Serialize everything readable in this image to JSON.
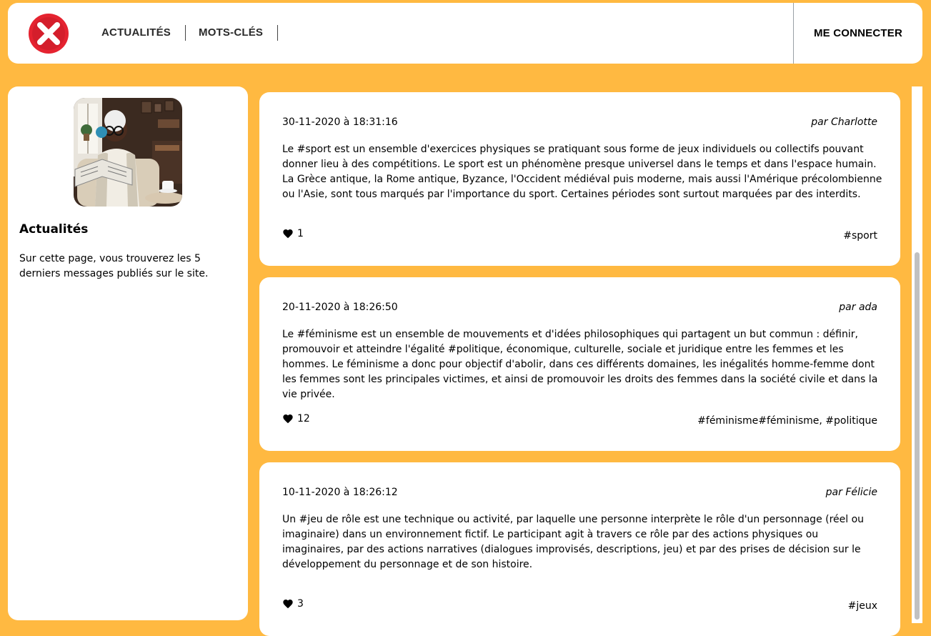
{
  "header": {
    "logo_icon": "close-x-icon",
    "nav": [
      "ACTUALITÉS",
      "MOTS-CLÉS"
    ],
    "login_label": "ME CONNECTER"
  },
  "sidebar": {
    "title": "Actualités",
    "text": "Sur cette page, vous trouverez les 5 derniers messages publiés sur le site."
  },
  "posts": [
    {
      "date": "30-11-2020 à 18:31:16",
      "author": "par Charlotte",
      "text": "Le #sport est un ensemble d'exercices physiques se pratiquant sous forme de jeux individuels ou collectifs pouvant donner lieu à des compétitions. Le sport est un phénomène presque universel dans le temps et dans l'espace humain. La Grèce antique, la Rome antique, Byzance, l'Occident médiéval puis moderne, mais aussi l'Amérique précolombienne ou l'Asie, sont tous marqués par l'importance du sport. Certaines périodes sont surtout marquées par des interdits.",
      "likes": "1",
      "tags": "#sport"
    },
    {
      "date": "20-11-2020 à 18:26:50",
      "author": "par ada",
      "text": "Le #féminisme est un ensemble de mouvements et d'idées philosophiques qui partagent un but commun : définir, promouvoir et atteindre l'égalité #politique, économique, culturelle, sociale et juridique entre les femmes et les hommes. Le féminisme a donc pour objectif d'abolir, dans ces différents domaines, les inégalités homme-femme dont les femmes sont les principales victimes, et ainsi de promouvoir les droits des femmes dans la société civile et dans la vie privée.",
      "likes": "12",
      "tags": "#féminisme#féminisme, #politique"
    },
    {
      "date": "10-11-2020 à 18:26:12",
      "author": "par Félicie",
      "text": "Un #jeu de rôle est une technique ou activité, par laquelle une personne interprète le rôle d'un personnage (réel ou imaginaire) dans un environnement fictif. Le participant agit à travers ce rôle par des actions physiques ou imaginaires, par des actions narratives (dialogues improvisés, descriptions, jeu) et par des prises de décision sur le développement du personnage et de son histoire.",
      "likes": "3",
      "tags": "#jeux"
    }
  ],
  "colors": {
    "background": "#ffb941",
    "logo_red": "#e52330"
  }
}
